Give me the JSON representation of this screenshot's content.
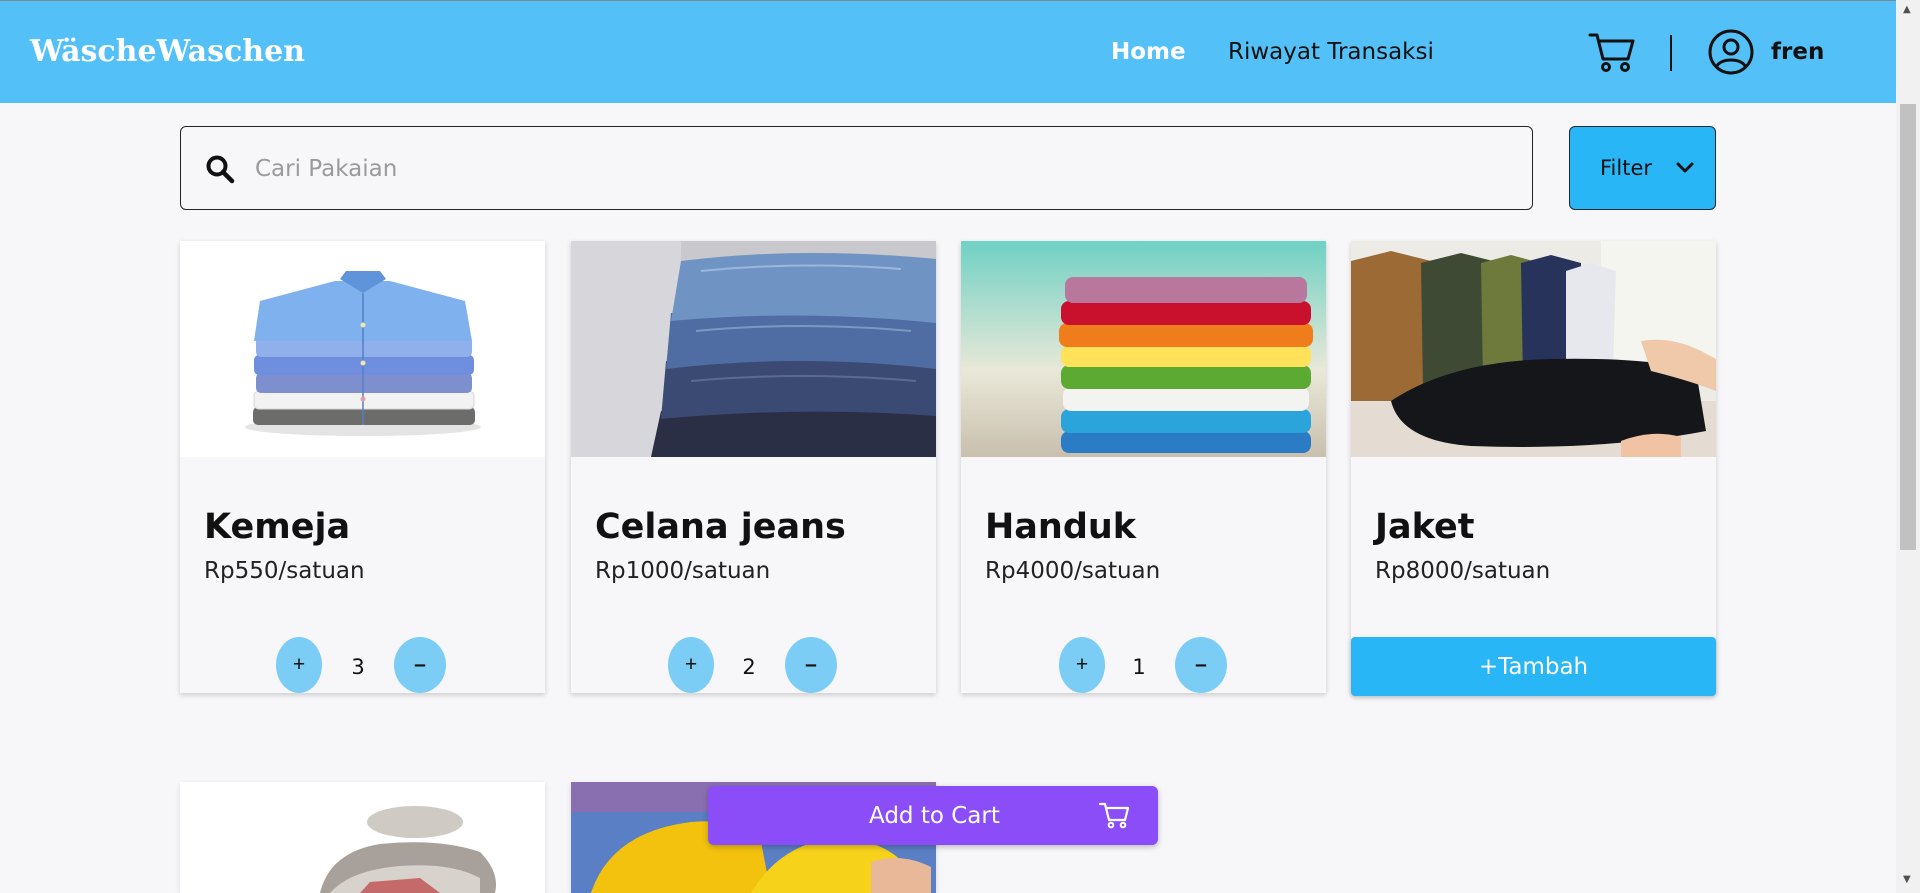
{
  "navbar": {
    "brand": "WäscheWaschen",
    "home_label": "Home",
    "history_label": "Riwayat Transaksi",
    "username": "fren"
  },
  "search": {
    "placeholder": "Cari Pakaian",
    "value": ""
  },
  "filter": {
    "label": "Filter"
  },
  "products": [
    {
      "name": "Kemeja",
      "price": "Rp550/satuan",
      "quantity": "3",
      "plus": "+",
      "minus": "–"
    },
    {
      "name": "Celana jeans",
      "price": "Rp1000/satuan",
      "quantity": "2",
      "plus": "+",
      "minus": "–"
    },
    {
      "name": "Handuk",
      "price": "Rp4000/satuan",
      "quantity": "1",
      "plus": "+",
      "minus": "–"
    },
    {
      "name": "Jaket",
      "price": "Rp8000/satuan",
      "add_label": "+Tambah"
    }
  ],
  "cart_bar": {
    "label": "Add to Cart"
  },
  "colors": {
    "navbar": "#53c1f8",
    "accent": "#29b6f6",
    "qty_button": "#7ccdf6",
    "cart_bar": "#8a4df7"
  }
}
